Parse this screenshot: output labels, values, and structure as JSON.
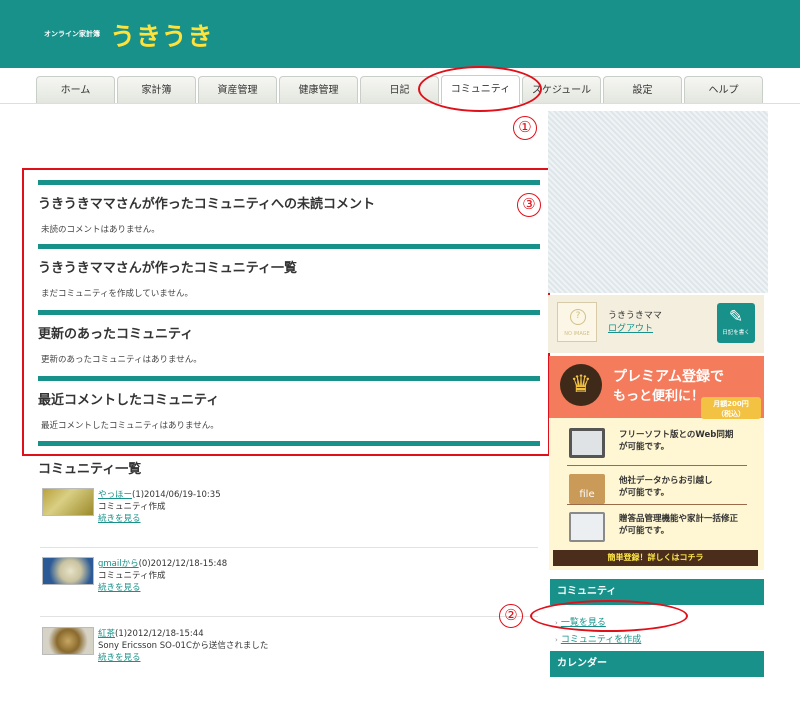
{
  "header": {
    "brand_small": "オンライン家計簿",
    "brand_big": "うきうき"
  },
  "tabs": [
    {
      "label": "ホーム"
    },
    {
      "label": "家計簿"
    },
    {
      "label": "資産管理"
    },
    {
      "label": "健康管理"
    },
    {
      "label": "日記"
    },
    {
      "label": "コミュニティ"
    },
    {
      "label": "スケジュール"
    },
    {
      "label": "設定"
    },
    {
      "label": "ヘルプ"
    }
  ],
  "annotations": {
    "n1": "①",
    "n2": "②",
    "n3": "③"
  },
  "main": {
    "sections": [
      {
        "title": "うきうきママさんが作ったコミュニティへの未読コメント",
        "text": "未読のコメントはありません。"
      },
      {
        "title": "うきうきママさんが作ったコミュニティ一覧",
        "text": "まだコミュニティを作成していません。"
      },
      {
        "title": "更新のあったコミュニティ",
        "text": "更新のあったコミュニティはありません。"
      },
      {
        "title": "最近コメントしたコミュニティ",
        "text": "最近コメントしたコミュニティはありません。"
      }
    ],
    "list_title": "コミュニティ一覧",
    "items": [
      {
        "name": "やっほー",
        "meta": "(1)2014/06/19-10:35",
        "desc": "コミュニティ作成",
        "more": "続きを見る"
      },
      {
        "name": "gmailから",
        "meta": "(0)2012/12/18-15:48",
        "desc": "コミュニティ作成",
        "more": "続きを見る"
      },
      {
        "name": "紅茶",
        "meta": "(1)2012/12/18-15:44",
        "desc": "Sony Ericsson SO-01Cから送信されました",
        "more": "続きを見る"
      }
    ]
  },
  "sidebar": {
    "profile": {
      "noimage": "NO IMAGE",
      "name": "うきうきママ",
      "logout": "ログアウト",
      "diary_button": "日記を書く"
    },
    "premium": {
      "title1": "プレミアム登録で",
      "title2": "もっと便利に！",
      "price_line1": "月額200円",
      "price_line2": "（税込）",
      "features": [
        {
          "text1": "フリーソフト版とのWeb同期",
          "text2": "が可能です。"
        },
        {
          "text1": "他社データからお引越し",
          "text2": "が可能です。"
        },
        {
          "text1": "贈答品管理機能や家計一括修正",
          "text2": "が可能です。"
        }
      ],
      "file_label": "file",
      "cta": "簡単登録！詳しくはコチラ"
    },
    "community": {
      "title": "コミュニティ",
      "links": [
        {
          "label": "一覧を見る"
        },
        {
          "label": "コミュニティを作成"
        }
      ]
    },
    "calendar_title": "カレンダー"
  },
  "colors": {
    "brand_teal": "#17918a",
    "brand_yellow": "#ffe23a",
    "annotation_red": "#e0101a",
    "premium_salmon": "#f47b5b"
  }
}
